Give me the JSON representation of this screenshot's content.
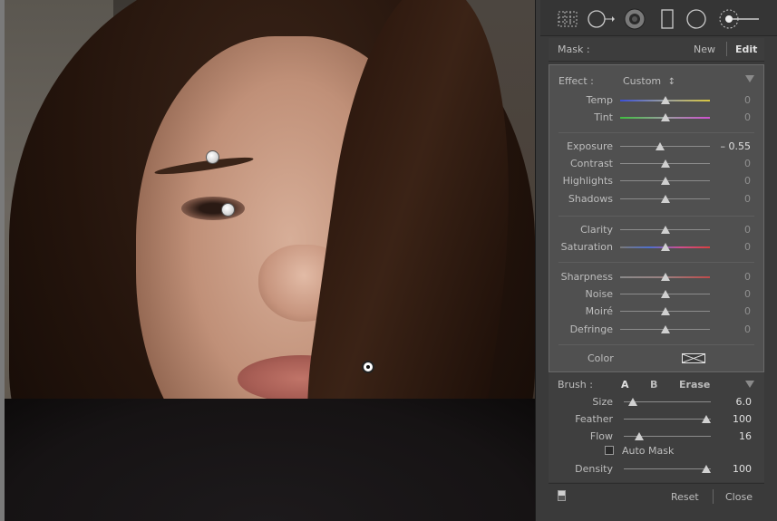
{
  "mask": {
    "label": "Mask :",
    "new_label": "New",
    "edit_label": "Edit"
  },
  "effect": {
    "label": "Effect :",
    "preset": "Custom",
    "preset_arrows": "↕",
    "groups": [
      [
        {
          "name": "Temp",
          "value": "0",
          "pos": 0.5,
          "track": "temp"
        },
        {
          "name": "Tint",
          "value": "0",
          "pos": 0.5,
          "track": "tint"
        }
      ],
      [
        {
          "name": "Exposure",
          "value": "– 0.55",
          "pos": 0.44,
          "track": "plain",
          "highlight": true
        },
        {
          "name": "Contrast",
          "value": "0",
          "pos": 0.5,
          "track": "plain"
        },
        {
          "name": "Highlights",
          "value": "0",
          "pos": 0.5,
          "track": "plain"
        },
        {
          "name": "Shadows",
          "value": "0",
          "pos": 0.5,
          "track": "plain"
        }
      ],
      [
        {
          "name": "Clarity",
          "value": "0",
          "pos": 0.5,
          "track": "plain"
        },
        {
          "name": "Saturation",
          "value": "0",
          "pos": 0.5,
          "track": "sat"
        }
      ],
      [
        {
          "name": "Sharpness",
          "value": "0",
          "pos": 0.5,
          "track": "sharp"
        },
        {
          "name": "Noise",
          "value": "0",
          "pos": 0.5,
          "track": "plain"
        },
        {
          "name": "Moiré",
          "value": "0",
          "pos": 0.5,
          "track": "plain"
        },
        {
          "name": "Defringe",
          "value": "0",
          "pos": 0.5,
          "track": "plain"
        }
      ]
    ],
    "color_label": "Color"
  },
  "brush": {
    "label": "Brush :",
    "tab_a": "A",
    "tab_b": "B",
    "tab_erase": "Erase",
    "sliders": [
      {
        "name": "Size",
        "value": "6.0",
        "pos": 0.06
      },
      {
        "name": "Feather",
        "value": "100",
        "pos": 1.0
      },
      {
        "name": "Flow",
        "value": "16",
        "pos": 0.14
      }
    ],
    "auto_mask": "Auto Mask",
    "density": {
      "name": "Density",
      "value": "100",
      "pos": 1.0
    }
  },
  "footer": {
    "reset_label": "Reset",
    "close_label": "Close"
  },
  "colors": {
    "panel_bg": "#3a3a3a",
    "effect_bg": "#505050",
    "text": "#bdbdbd",
    "value": "#8f8f8f",
    "value_highlight": "#e0e0e0"
  },
  "icons": [
    "grid-overlay-icon",
    "spot-removal-icon",
    "red-eye-icon",
    "graduated-filter-icon",
    "radial-filter-icon",
    "adjustment-brush-icon"
  ]
}
